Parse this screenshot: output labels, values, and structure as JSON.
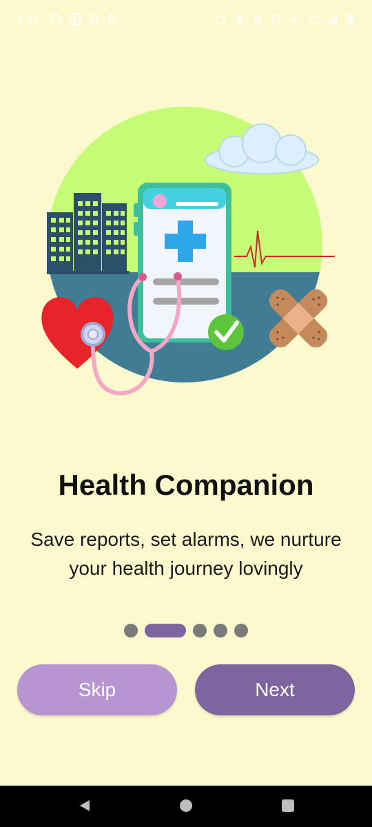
{
  "status_bar": {
    "time": "4:48",
    "left_icons": [
      "whatsapp-icon",
      "screenshot-icon",
      "battery-saver-icon",
      "play-store-icon"
    ],
    "right_icons": [
      "alarm-icon",
      "bluetooth-icon",
      "mute-icon",
      "vibrate-icon",
      "hotspot-icon",
      "network-4g-icon",
      "signal-icon",
      "battery-icon"
    ]
  },
  "onboarding": {
    "title": "Health Companion",
    "description": "Save reports, set alarms, we nurture your health journey lovingly",
    "page_indicator": {
      "total": 5,
      "current": 2
    }
  },
  "buttons": {
    "skip_label": "Skip",
    "next_label": "Next"
  },
  "colors": {
    "background": "#FBF9CD",
    "accent": "#7E659F",
    "skip_button": "#B794D2",
    "inactive_dot": "#7A7A7A"
  },
  "navigation": [
    "back-icon",
    "home-icon",
    "recents-icon"
  ]
}
